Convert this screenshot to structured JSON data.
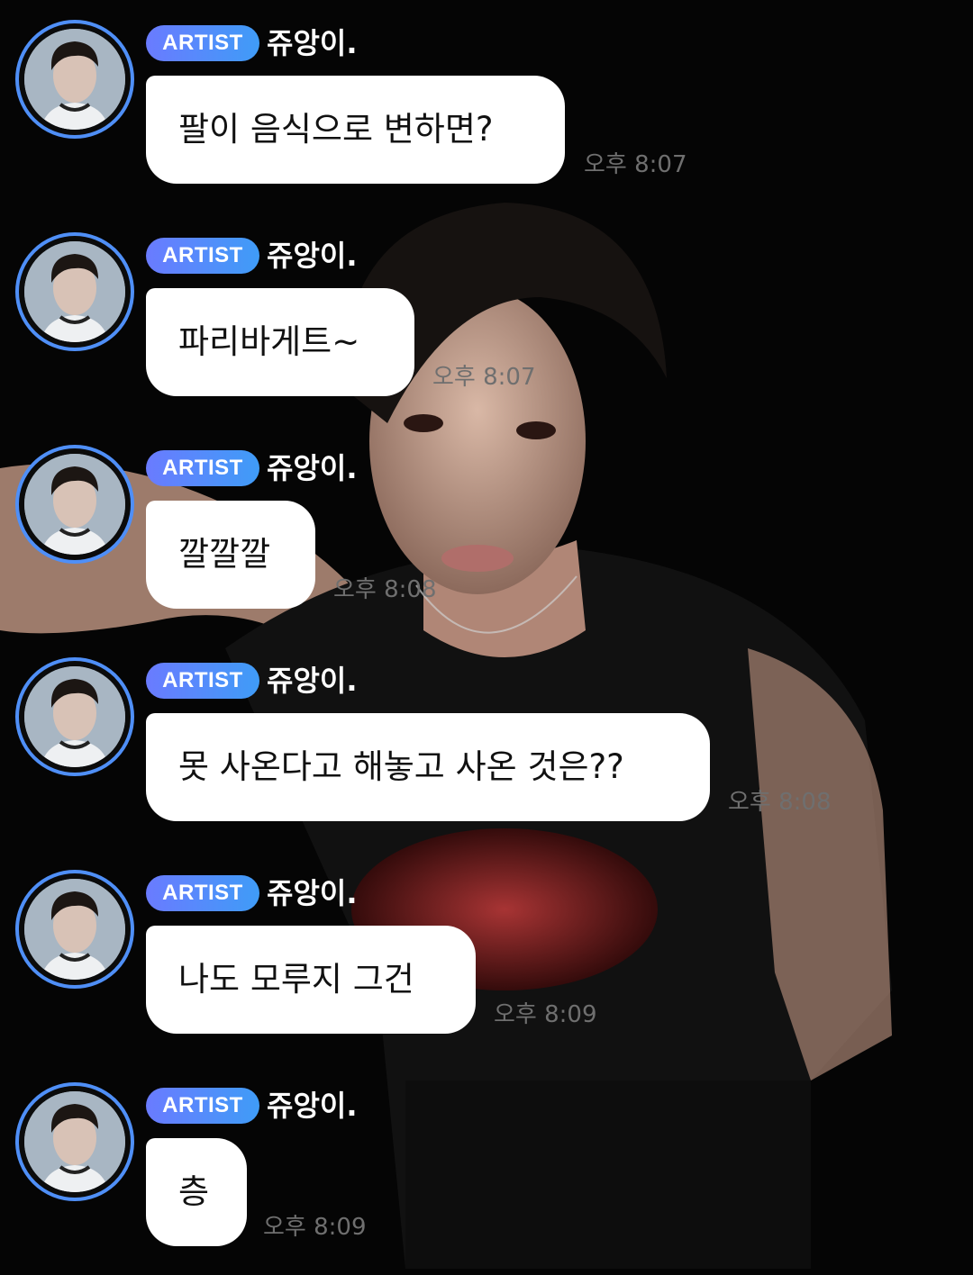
{
  "chat": {
    "messages": [
      {
        "badge": "ARTIST",
        "name": "쥬앙이.",
        "text": "팔이 음식으로 변하면?",
        "time": "오후 8:07"
      },
      {
        "badge": "ARTIST",
        "name": "쥬앙이.",
        "text": "파리바게트~",
        "time": "오후 8:07"
      },
      {
        "badge": "ARTIST",
        "name": "쥬앙이.",
        "text": "깔깔깔",
        "time": "오후 8:08"
      },
      {
        "badge": "ARTIST",
        "name": "쥬앙이.",
        "text": "못 사온다고 해놓고 사온 것은??",
        "time": "오후 8:08"
      },
      {
        "badge": "ARTIST",
        "name": "쥬앙이.",
        "text": "나도 모루지 그건",
        "time": "오후 8:09"
      },
      {
        "badge": "ARTIST",
        "name": "쥬앙이.",
        "text": "층",
        "time": "오후 8:09"
      }
    ]
  },
  "colors": {
    "badge_start": "#6a7bff",
    "badge_end": "#3f9cf7",
    "avatar_ring": "#4f8ff7",
    "bubble": "#ffffff",
    "background": "#050505"
  },
  "icons": {
    "avatar": "profile-photo"
  }
}
